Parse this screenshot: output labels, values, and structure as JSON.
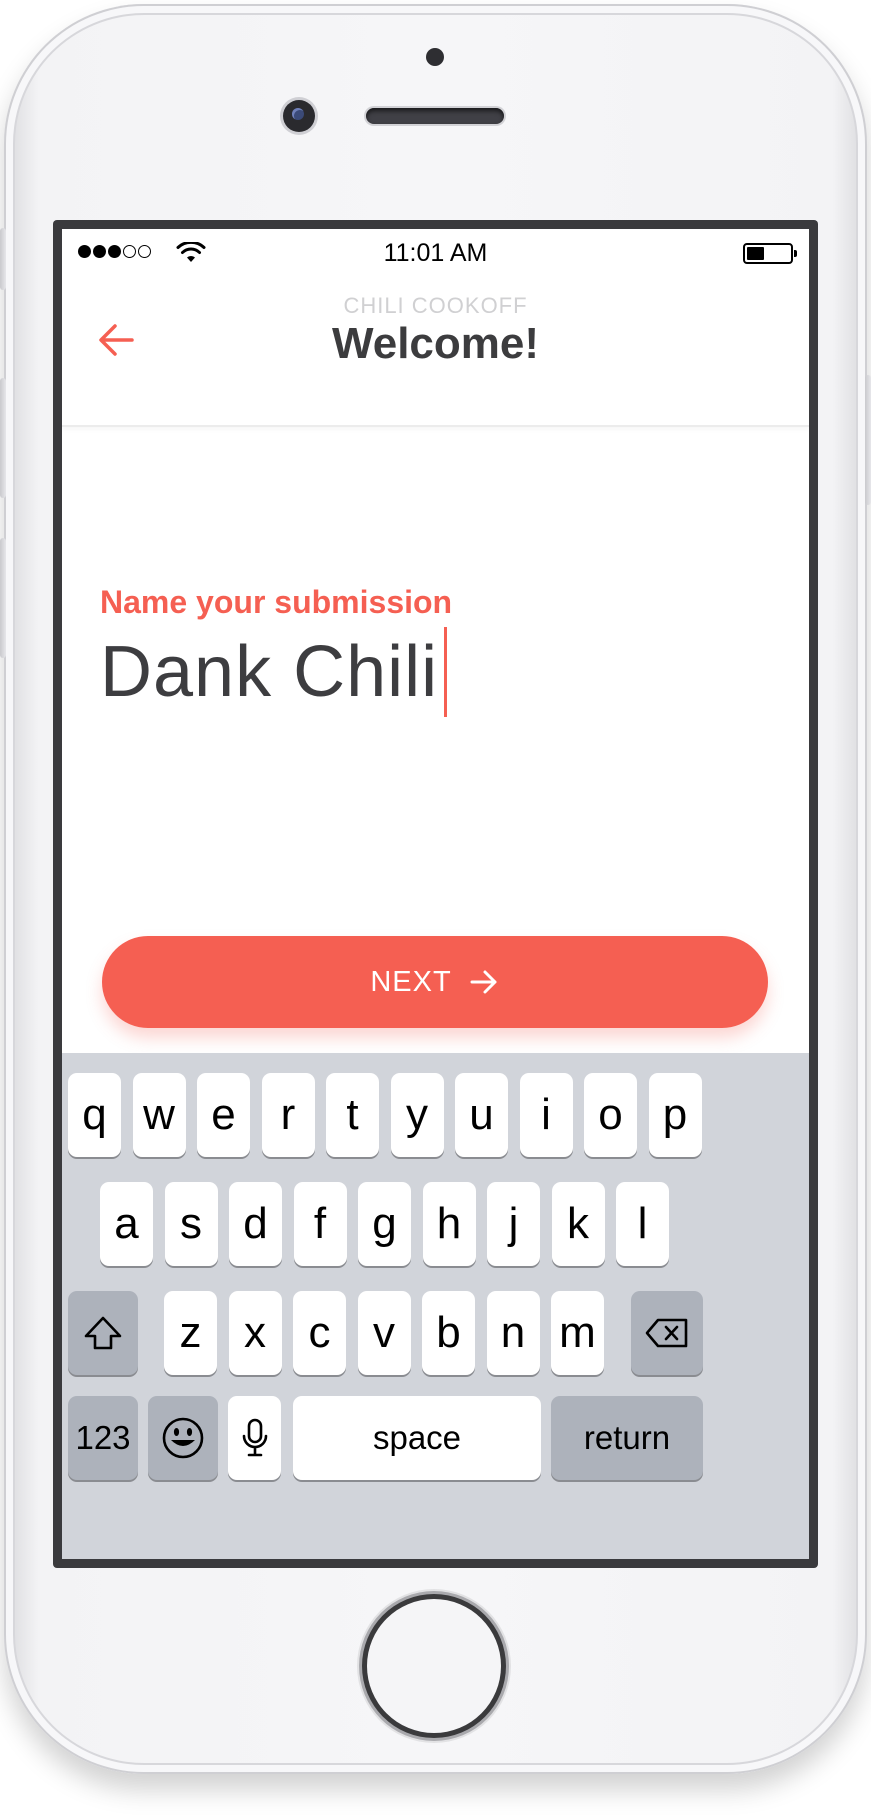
{
  "status_bar": {
    "time": "11:01 AM",
    "signal_bars": 3,
    "signal_max": 5,
    "battery_level": 0.4
  },
  "nav": {
    "subtitle": "CHILI COOKOFF",
    "title": "Welcome!",
    "back_icon": "arrow-left-icon"
  },
  "form": {
    "label": "Name your submission",
    "value": "Dank Chili"
  },
  "next_button": {
    "label": "NEXT",
    "icon": "arrow-right-icon"
  },
  "keyboard": {
    "row1": [
      "q",
      "w",
      "e",
      "r",
      "t",
      "y",
      "u",
      "i",
      "o",
      "p"
    ],
    "row2": [
      "a",
      "s",
      "d",
      "f",
      "g",
      "h",
      "j",
      "k",
      "l"
    ],
    "row3": [
      "z",
      "x",
      "c",
      "v",
      "b",
      "n",
      "m"
    ],
    "numbers": "123",
    "space": "space",
    "return": "return",
    "shift_icon": "shift-icon",
    "delete_icon": "backspace-icon",
    "emoji_icon": "emoji-icon",
    "mic_icon": "microphone-icon"
  },
  "colors": {
    "accent": "#f55f52",
    "keyboard_bg": "#d1d4da",
    "title": "#3c3c3e"
  }
}
